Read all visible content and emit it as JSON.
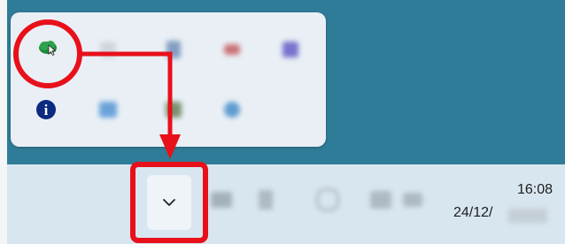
{
  "clock": {
    "time": "16:08",
    "date_visible": "24/12/"
  },
  "tray_popup": {
    "icons": [
      {
        "name": "green-cloud-sync-icon",
        "highlighted": true
      },
      {
        "name": "blurred-tray-icon-2"
      },
      {
        "name": "blurred-tray-icon-3"
      },
      {
        "name": "blurred-tray-icon-4"
      },
      {
        "name": "blurred-tray-icon-5"
      },
      {
        "name": "info-icon",
        "glyph": "i"
      },
      {
        "name": "blurred-tray-icon-7"
      },
      {
        "name": "blurred-tray-icon-8"
      },
      {
        "name": "blurred-tray-icon-9"
      }
    ]
  },
  "taskbar": {
    "overflow_chevron": "show-hidden-icons"
  },
  "colors": {
    "desktop": "#2f7c98",
    "taskbar": "#d8e6ef",
    "popup": "#e9eff5",
    "annotation_red": "#e8101a",
    "info_blue": "#0b2a80",
    "cloud_green": "#1f8a3a"
  }
}
